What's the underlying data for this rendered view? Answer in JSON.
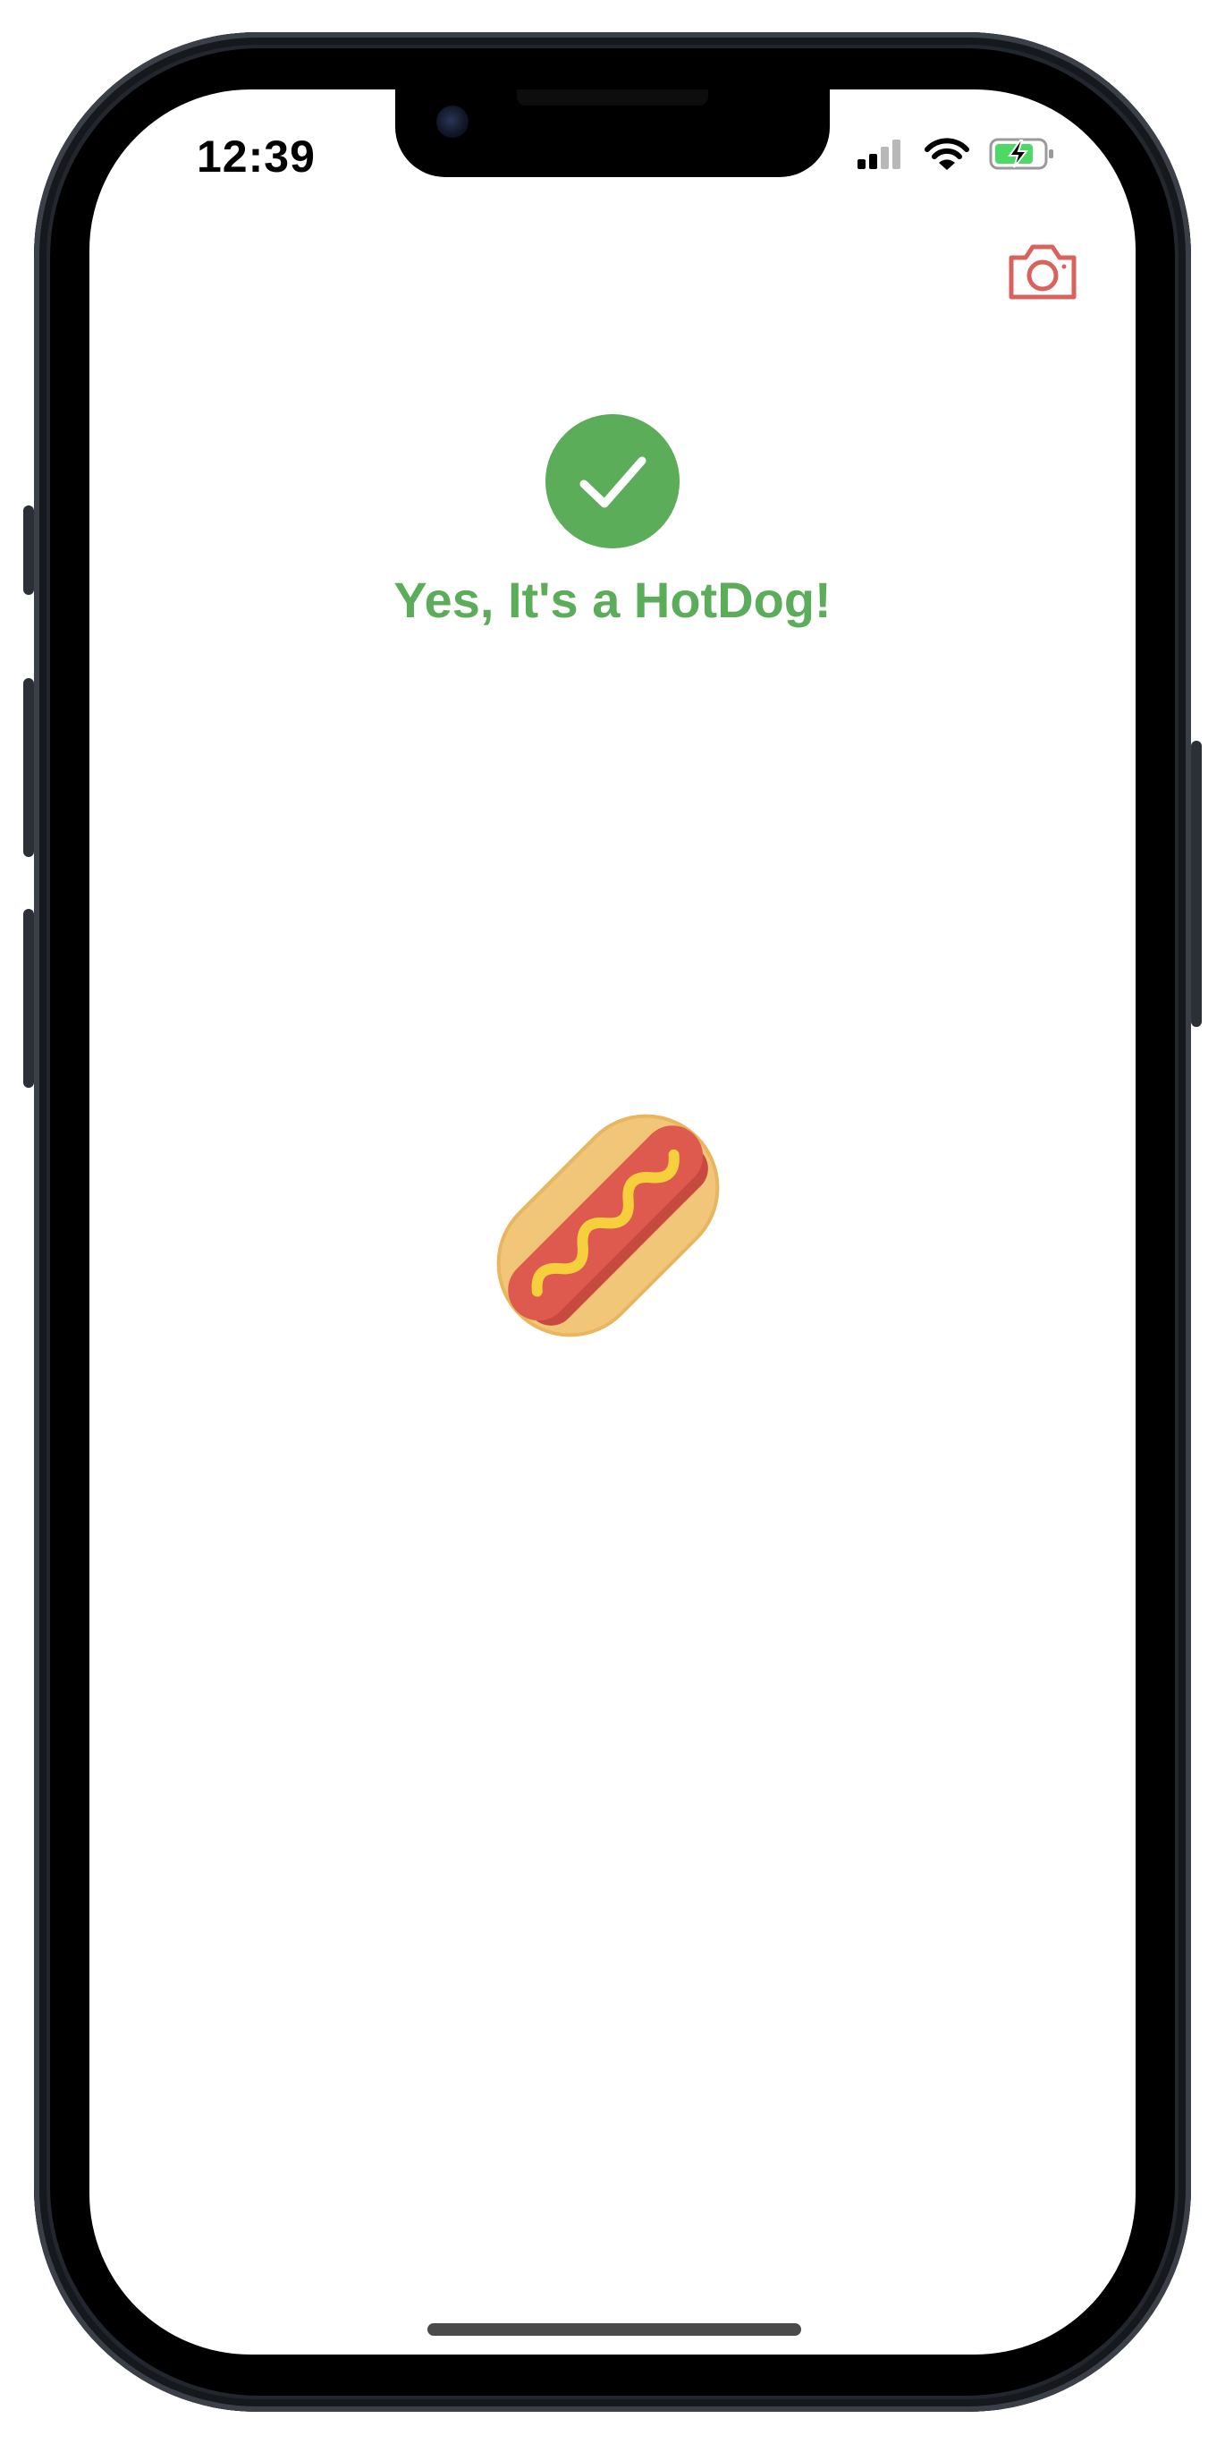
{
  "status_bar": {
    "time": "12:39",
    "icons": [
      "cellular-signal-icon",
      "wifi-icon",
      "battery-charging-icon"
    ]
  },
  "header": {
    "camera_button_icon": "camera-icon",
    "camera_color": "#d9625c"
  },
  "result": {
    "icon": "checkmark-icon",
    "title": "Yes, It's a HotDog!",
    "color": "#5cad5a"
  },
  "image": {
    "icon": "hotdog-icon"
  }
}
